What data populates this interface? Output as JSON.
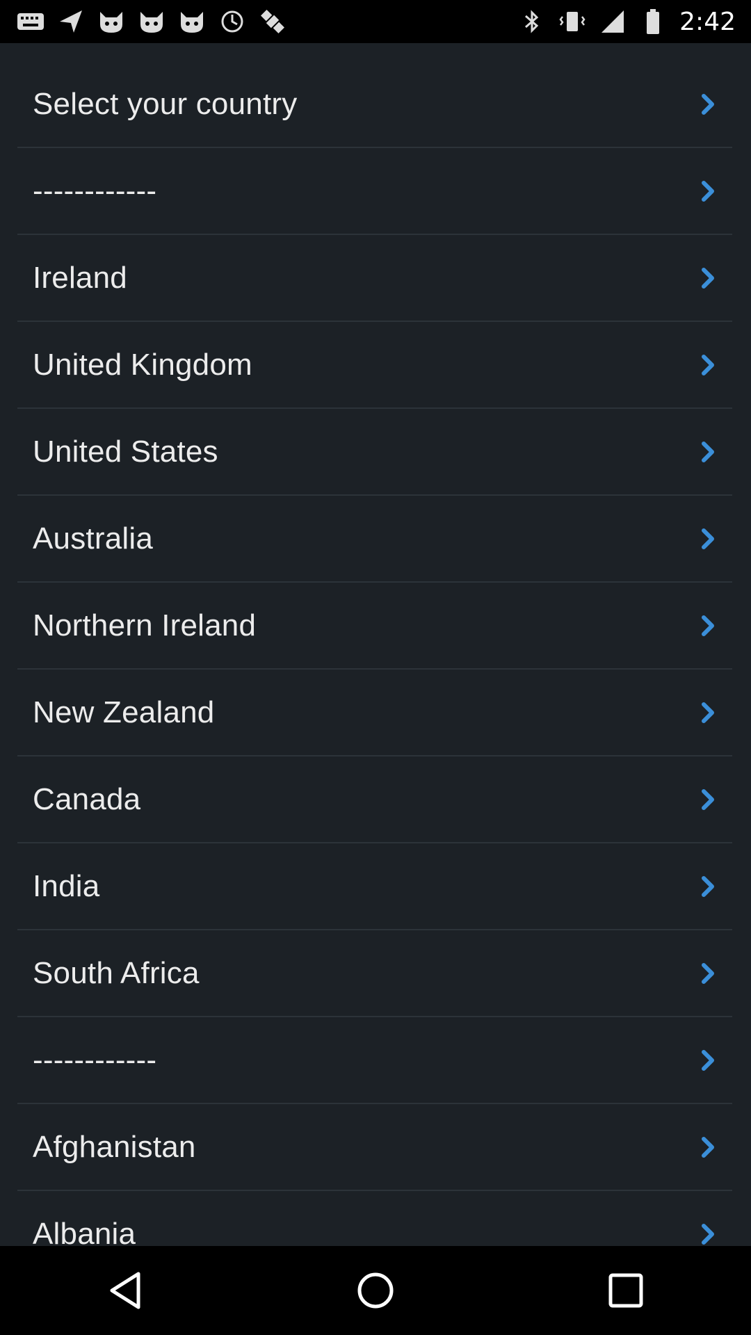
{
  "status_bar": {
    "time": "2:42",
    "left_icons": [
      "keyboard-icon",
      "send-icon",
      "cat-face-icon",
      "cat-face-icon",
      "cat-face-icon",
      "sync-circle-icon",
      "satellite-icon"
    ],
    "right_icons": [
      "bluetooth-icon",
      "vibrate-icon",
      "signal-icon",
      "battery-icon"
    ]
  },
  "list": {
    "items": [
      {
        "label": "Select your country"
      },
      {
        "label": "------------"
      },
      {
        "label": "Ireland"
      },
      {
        "label": "United Kingdom"
      },
      {
        "label": "United States"
      },
      {
        "label": "Australia"
      },
      {
        "label": "Northern Ireland"
      },
      {
        "label": "New Zealand"
      },
      {
        "label": "Canada"
      },
      {
        "label": "India"
      },
      {
        "label": "South Africa"
      },
      {
        "label": "------------"
      },
      {
        "label": "Afghanistan"
      },
      {
        "label": "Albania"
      }
    ]
  },
  "colors": {
    "background": "#1c2126",
    "chevron": "#3b8fd9",
    "divider": "#2c3339"
  }
}
